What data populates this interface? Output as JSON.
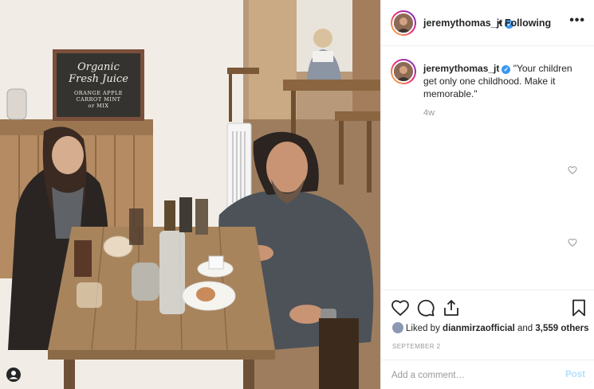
{
  "post": {
    "username": "jeremythomas_jt",
    "follow_status": "• Following",
    "more_label": "•••",
    "caption": "\"Your children get only one childhood. Make it memorable.\"",
    "age": "4w",
    "likes_prefix": "Liked by",
    "liked_by_user": "dianmirzaofficial",
    "likes_suffix": "and",
    "likes_count": "3,559 others",
    "date": "SEPTEMBER 2",
    "comment_placeholder": "Add a comment…",
    "post_label": "Post"
  },
  "photo": {
    "board_line1": "Organic",
    "board_line2": "Fresh Juice",
    "board_line3": "ORANGE  APPLE",
    "board_line4": "CARROT  MINT",
    "board_line5": "or MIX"
  },
  "icons": {
    "like": "heart-icon",
    "comment": "comment-icon",
    "share": "share-icon",
    "save": "bookmark-icon",
    "verified": "verified-badge-icon"
  },
  "colors": {
    "accent_blue": "#3897f0",
    "post_disabled": "#b2dffc",
    "text": "#262626",
    "muted": "#999999"
  }
}
